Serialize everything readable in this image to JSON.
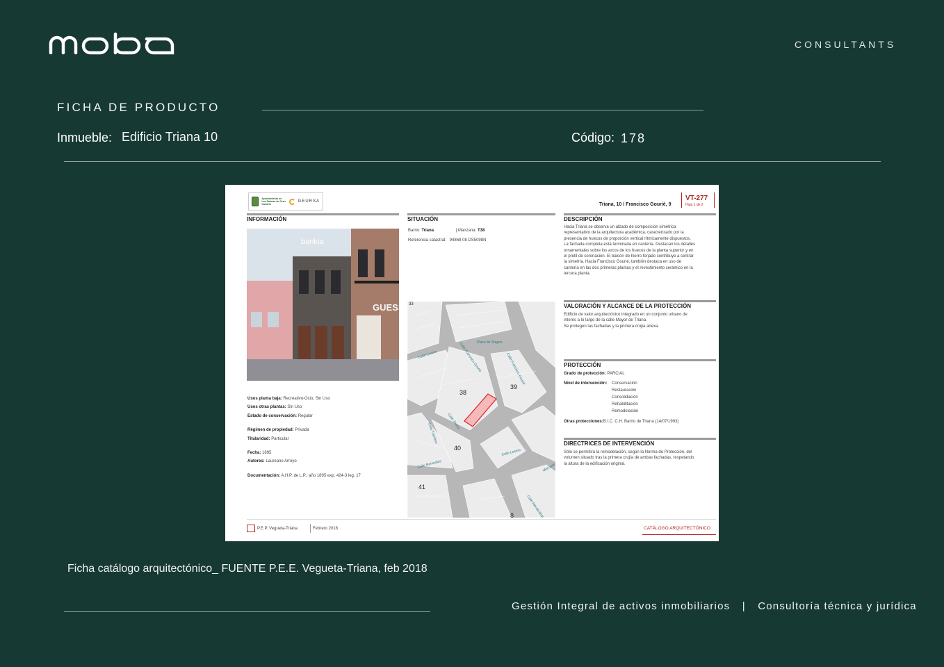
{
  "brand": {
    "logo_text": "moba",
    "tagline": "CONSULTANTS"
  },
  "header": {
    "title": "FICHA DE PRODUCTO",
    "inmueble_label": "Inmueble:",
    "inmueble_value": "Edificio Triana 10",
    "codigo_label": "Código:",
    "codigo_value": "178"
  },
  "sheet": {
    "org1": "Ayuntamiento de Las Palmas de Gran Canaria",
    "org2": "GEURSA",
    "code": "VT-277",
    "address": "Triana, 10 / Francisco Gourié, 9",
    "page": "Hoja 1 de 2",
    "informacion": {
      "title": "INFORMACIÓN",
      "sign1": "bankia",
      "sign2": "GUESS",
      "rows": [
        {
          "label": "Usos planta baja:",
          "value": "Recreativo-Ocio, Sin Uso"
        },
        {
          "label": "Usos otras plantas:",
          "value": "Sin Uso"
        },
        {
          "label": "Estado de conservación:",
          "value": "Regular"
        },
        {
          "label": "Régimen de propiedad:",
          "value": "Privada"
        },
        {
          "label": "Titularidad:",
          "value": "Particular"
        },
        {
          "label": "Fecha:",
          "value": "1895"
        },
        {
          "label": "Autores:",
          "value": "Laureano Arroyo"
        },
        {
          "label": "Documentación:",
          "value": "A.H.P. de L.P., año 1895 exp. 424-3 leg. 17"
        }
      ]
    },
    "situacion": {
      "title": "SITUACIÓN",
      "barrio_label": "Barrio:",
      "barrio_value": "Triana",
      "manzana_label": "Manzana:",
      "manzana_value": "T38",
      "ref_label": "Referencia catastral:",
      "ref_value": "94868 08 DS5098N",
      "map": {
        "plaza": "Plaza de Stagno",
        "streets": [
          "Calle Losero",
          "Calle Francisco Gourié",
          "Calle Triana",
          "Calle Losero",
          "Calle Remedios",
          "Calle Travieso",
          "Calle Mendizábal",
          "Mercado"
        ],
        "blocks": [
          "38",
          "39",
          "40",
          "41",
          "8",
          "33"
        ]
      }
    },
    "descripcion": {
      "title": "DESCRIPCIÓN",
      "lines": [
        "Hacia Triana se observa un alzado de composición simétrica",
        "representativo de la arquitectura académica, caracterizado por la",
        "presencia de huecos de proporción vertical rítmicamente dispuestos.",
        "La fachada completa está terminada en cantería. Destacan los detalles",
        "ornamentales sobre los arcos de los huecos de la planta superior y en",
        "el pretil de coronación. El balcón de hierro forjado contribuye a centrar",
        "la simetría. Hacia Francisco Gourié, también destaca en uso de",
        "cantería en las dos primeras plantas y el revestimiento cerámico en la",
        "tercera planta."
      ]
    },
    "valoracion": {
      "title": "VALORACIÓN Y ALCANCE DE LA PROTECCIÓN",
      "lines": [
        "Edificio de valor arquitectónico integrado en un conjunto urbano de",
        "interés a lo largo de la calle Mayor de Triana.",
        "Se protegen las fachadas y la primera crujía anexa."
      ]
    },
    "proteccion": {
      "title": "PROTECCIÓN",
      "grado_label": "Grado de protección:",
      "grado_value": "PARCIAL",
      "nivel_label": "Nivel de intervención:",
      "niveles": [
        "Conservación",
        "Restauración",
        "Consolidación",
        "Rehabilitación",
        "Remodelación"
      ],
      "otras_label": "Otras protecciones:",
      "otras_value": "B.I.C. C.H. Barrio de Triana (14/07/1993)"
    },
    "directrices": {
      "title": "DIRECTRICES DE INTERVENCIÓN",
      "lines": [
        "Sólo se permitirá la remodelación, según la Norma de Protección, del",
        "volumen situado tras la primera crujía de ambas fachadas, respetando",
        "la altura de la edificación original."
      ]
    },
    "footer_left": "P.E.P. Vegueta-Triana",
    "footer_date": "Febrero 2018",
    "footer_right": "CATÁLOGO ARQUITECTÓNICO"
  },
  "caption": "Ficha catálogo arquitectónico_ FUENTE P.E.E. Vegueta-Triana, feb 2018",
  "footer": {
    "left": "Gestión Integral de activos inmobiliarios",
    "separator": "|",
    "right": "Consultoría técnica y jurídica"
  }
}
